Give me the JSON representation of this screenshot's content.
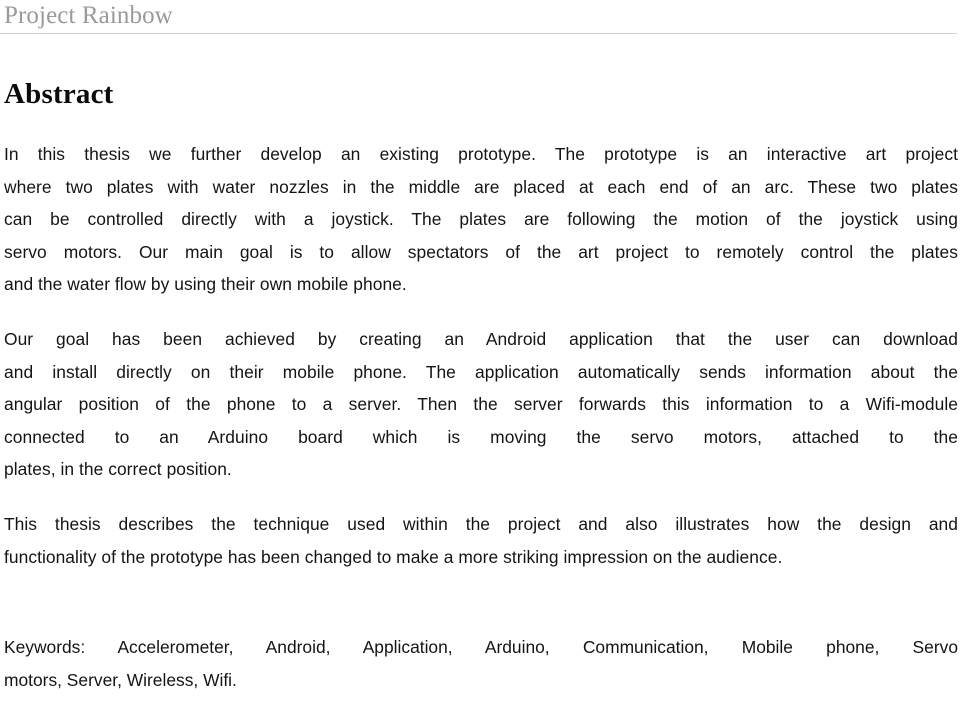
{
  "document": {
    "running_header": "Project Rainbow",
    "heading": "Abstract"
  },
  "abstract": {
    "paragraph_1": {
      "lines": [
        "In this thesis we further develop an existing prototype. The prototype is an interactive art project",
        "where two plates with water nozzles in the middle are placed at each end of an arc. These two plates",
        "can be controlled directly with a joystick. The plates are following the motion of the joystick using",
        "servo motors. Our main goal is to allow spectators of the art project to remotely control the plates",
        "and the water flow by using their own mobile phone."
      ]
    },
    "paragraph_2": {
      "lines": [
        "Our goal has been achieved by creating an Android application that the user can download",
        "and install directly on their mobile phone. The application automatically sends information about the",
        "angular position of the phone to a server. Then the server forwards this information to a Wifi-module",
        "connected to an Arduino board which is moving the servo motors, attached to the",
        "plates, in the correct position."
      ]
    },
    "paragraph_3": {
      "lines": [
        "This thesis describes the technique used within the project and also illustrates how the design and",
        "functionality of the prototype has been changed to make a more striking impression on the audience."
      ]
    },
    "keywords": {
      "label": "Keywords:",
      "lines": [
        "Keywords: Accelerometer, Android, Application, Arduino, Communication, Mobile phone, Servo",
        "motors, Server, Wireless, Wifi."
      ],
      "terms": [
        "Accelerometer",
        "Android",
        "Application",
        "Arduino",
        "Communication",
        "Mobile phone",
        "Servo motors",
        "Server",
        "Wireless",
        "Wifi"
      ]
    }
  },
  "colors": {
    "page_background": "#ffffff",
    "header_text": "#9a9a9e",
    "header_rule": "#d0d0d4",
    "heading_text": "#0b0b0b",
    "body_text": "#141414"
  }
}
